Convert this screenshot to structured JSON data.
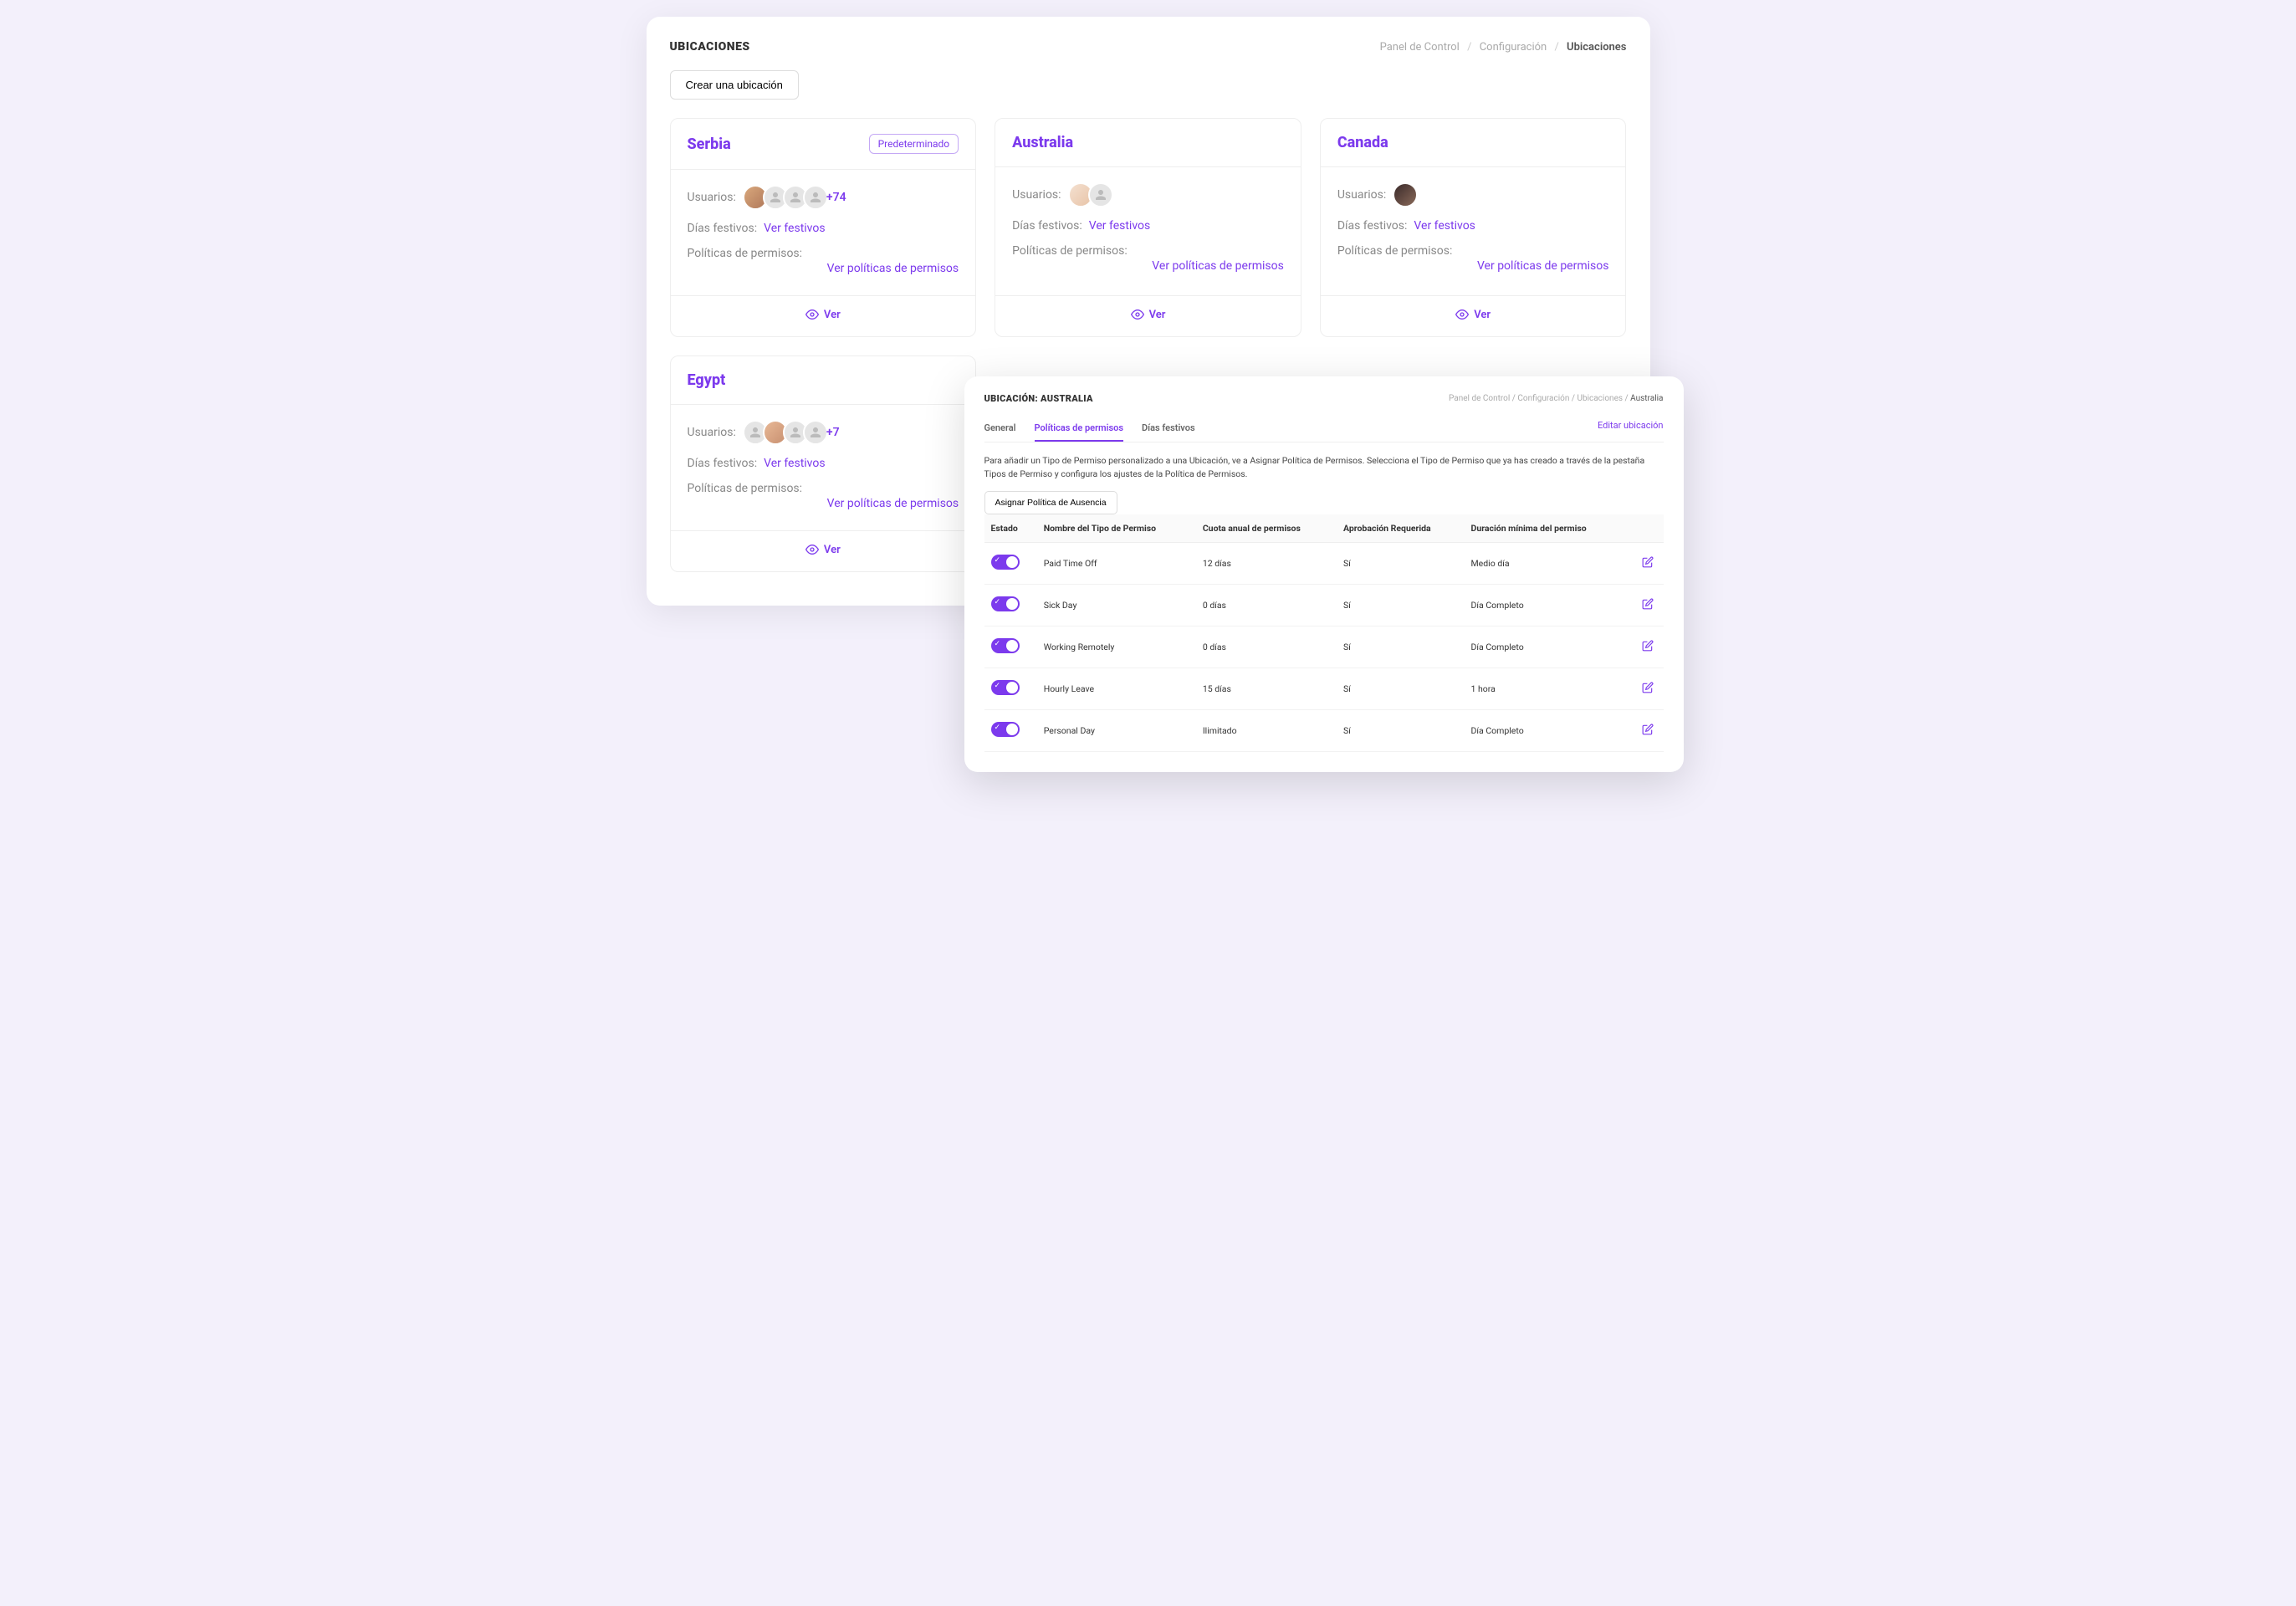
{
  "header": {
    "title": "UBICACIONES",
    "breadcrumb": {
      "dashboard": "Panel de Control",
      "config": "Configuración",
      "current": "Ubicaciones"
    },
    "create_button": "Crear una ubicación"
  },
  "labels": {
    "users": "Usuarios:",
    "holidays": "Días festivos:",
    "view_holidays": "Ver festivos",
    "leave_policies": "Políticas de permisos:",
    "view_policies": "Ver políticas de permisos",
    "view": "Ver",
    "default_badge": "Predeterminado"
  },
  "locations": [
    {
      "name": "Serbia",
      "is_default": true,
      "overflow": "+74"
    },
    {
      "name": "Australia",
      "is_default": false,
      "overflow": ""
    },
    {
      "name": "Canada",
      "is_default": false,
      "overflow": ""
    },
    {
      "name": "Egypt",
      "is_default": false,
      "overflow": "+7"
    }
  ],
  "detail": {
    "title": "UBICACIÓN: AUSTRALIA",
    "breadcrumb": {
      "dashboard": "Panel de Control",
      "config": "Configuración",
      "locations": "Ubicaciones",
      "current": "Australia"
    },
    "tabs": {
      "general": "General",
      "policies": "Políticas de permisos",
      "holidays": "Días festivos"
    },
    "edit_link": "Editar ubicación",
    "description": "Para añadir un Tipo de Permiso personalizado a una Ubicación, ve a Asignar Política de Permisos. Selecciona el Tipo de Permiso que ya has creado a través de la pestaña Tipos de Permiso y configura los ajustes de la Política de Permisos.",
    "assign_button": "Asignar Política de Ausencia",
    "columns": {
      "status": "Estado",
      "name": "Nombre del Tipo de Permiso",
      "quota": "Cuota anual de permisos",
      "approval": "Aprobación Requerida",
      "min_duration": "Duración mínima del permiso"
    },
    "rows": [
      {
        "name": "Paid Time Off",
        "quota": "12 días",
        "approval": "Sí",
        "min": "Medio día"
      },
      {
        "name": "Sick Day",
        "quota": "0 días",
        "approval": "Sí",
        "min": "Día Completo"
      },
      {
        "name": "Working Remotely",
        "quota": "0 días",
        "approval": "Sí",
        "min": "Día Completo"
      },
      {
        "name": "Hourly Leave",
        "quota": "15 días",
        "approval": "Sí",
        "min": "1 hora"
      },
      {
        "name": "Personal Day",
        "quota": "Ilimitado",
        "approval": "Sí",
        "min": "Día Completo"
      }
    ]
  }
}
